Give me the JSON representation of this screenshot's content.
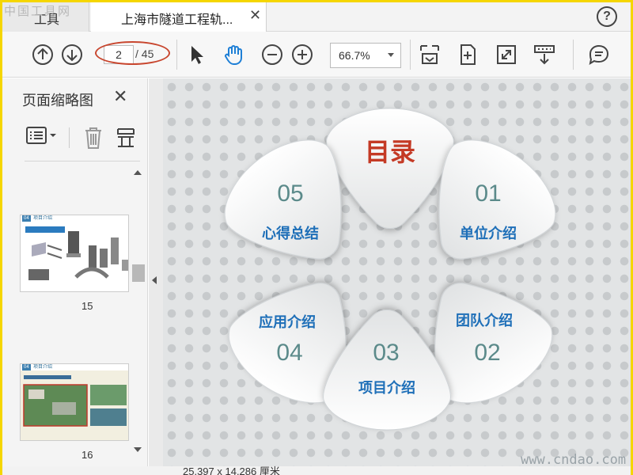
{
  "watermark": {
    "top": "中国工具网",
    "bottom": "www.cndao.com"
  },
  "tabs": {
    "tools": "工具",
    "document": "上海市隧道工程轨...",
    "close_glyph": "✕"
  },
  "toolbar": {
    "current_page": "2",
    "total_pages": "/ 45",
    "zoom": "66.7%"
  },
  "sidebar": {
    "title": "页面缩略图",
    "thumbnails": [
      {
        "page": "15",
        "header_tag": "04",
        "header_text": "项目介绍"
      },
      {
        "page": "16",
        "header_tag": "04",
        "header_text": "项目介绍"
      }
    ]
  },
  "slide": {
    "title": "目录",
    "petals": [
      {
        "num": "01",
        "label": "单位介绍"
      },
      {
        "num": "02",
        "label": "团队介绍"
      },
      {
        "num": "03",
        "label": "项目介绍"
      },
      {
        "num": "04",
        "label": "应用介绍"
      },
      {
        "num": "05",
        "label": "心得总结"
      }
    ]
  },
  "status": {
    "size": "25.397 x 14.286 厘米"
  },
  "colors": {
    "title_red": "#c43a25",
    "label_blue": "#1e6fb8",
    "num_teal": "#5b8a8a",
    "annot_red": "#c8462e"
  }
}
